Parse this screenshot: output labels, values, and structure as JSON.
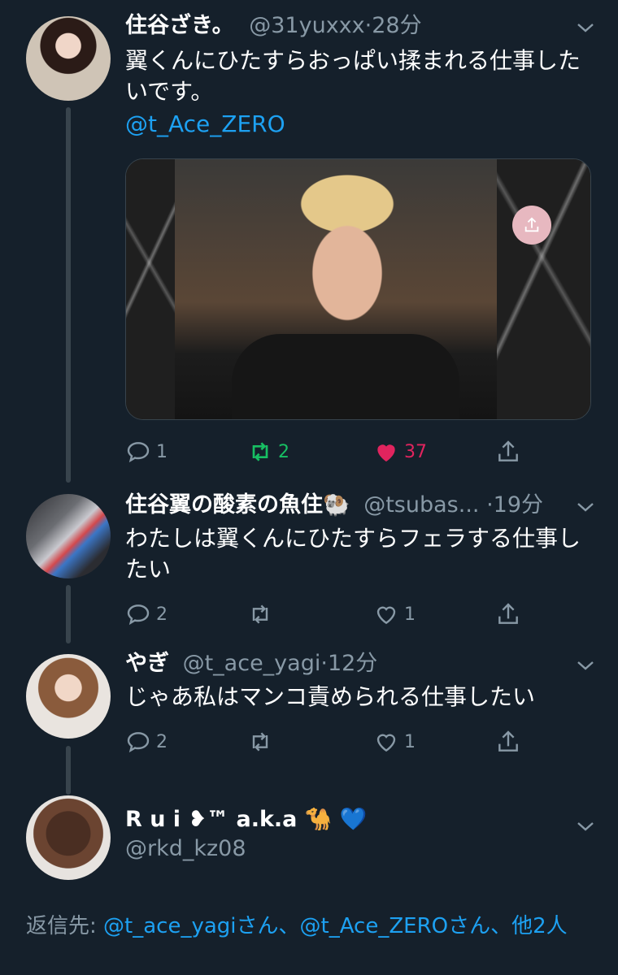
{
  "tweets": [
    {
      "name": "住谷ざき。",
      "handle": "@31yuxxx",
      "time": "28分",
      "text": "翼くんにひたすらおっぱい揉まれる仕事したいです。",
      "mention": "@t_Ace_ZERO",
      "replies": "1",
      "retweets": "2",
      "likes": "37"
    },
    {
      "name": "住谷翼の酸素の魚住🐏",
      "handle": "@tsubas...",
      "time": "19分",
      "text": "わたしは翼くんにひたすらフェラする仕事したい",
      "replies": "2",
      "retweets": "",
      "likes": "1"
    },
    {
      "name": "やぎ",
      "handle": "@t_ace_yagi",
      "time": "12分",
      "text": "じゃあ私はマンコ責められる仕事したい",
      "replies": "2",
      "retweets": "",
      "likes": "1"
    },
    {
      "name": "R u i ❥™ a.k.a 🐪 💙",
      "handle": "@rkd_kz08"
    }
  ],
  "reply_to": {
    "prefix": "返信先: ",
    "user1": "@t_ace_yagi",
    "suffix1": "さん、",
    "user2": "@t_Ace_ZERO",
    "suffix2": "さん、",
    "others": "他2人"
  },
  "colors": {
    "background": "#15202b",
    "link": "#1da1f2",
    "retweet": "#17bf63",
    "like": "#e0245e",
    "muted": "#8899a6"
  },
  "icons": [
    "reply-icon",
    "retweet-icon",
    "heart-icon",
    "share-icon",
    "chevron-down-icon"
  ]
}
